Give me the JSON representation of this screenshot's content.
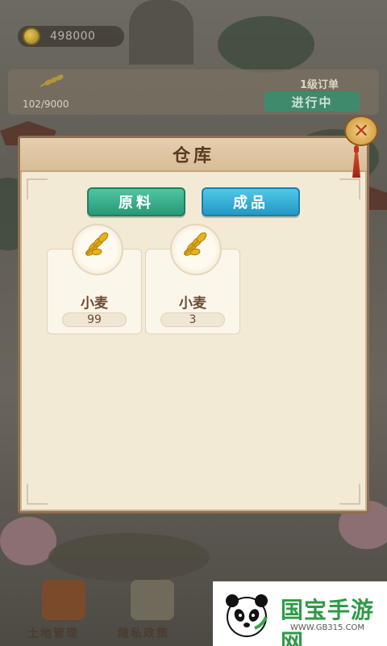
{
  "top": {
    "coins": "498000"
  },
  "order": {
    "progress": "102/9000",
    "level_label": "1级订单",
    "status": "进行中"
  },
  "warehouse": {
    "title": "仓库",
    "tabs": [
      {
        "label": "原料"
      },
      {
        "label": "成品"
      }
    ],
    "items": [
      {
        "name": "小麦",
        "count": "99",
        "icon": "wheat-icon"
      },
      {
        "name": "小麦",
        "count": "3",
        "icon": "wheat-icon"
      }
    ]
  },
  "bottom_nav": {
    "items": [
      {
        "label": "土地管理",
        "icon": "gate-icon"
      },
      {
        "label": "隐私政策",
        "icon": "scroll-icon"
      }
    ]
  },
  "watermark": {
    "title": "国宝手游网",
    "url": "WWW.GB315.COM"
  },
  "colors": {
    "tab_raw": "#28987a",
    "tab_product": "#2398c4",
    "dialog_bg": "#f3ead6",
    "title_text": "#5a3a22"
  }
}
